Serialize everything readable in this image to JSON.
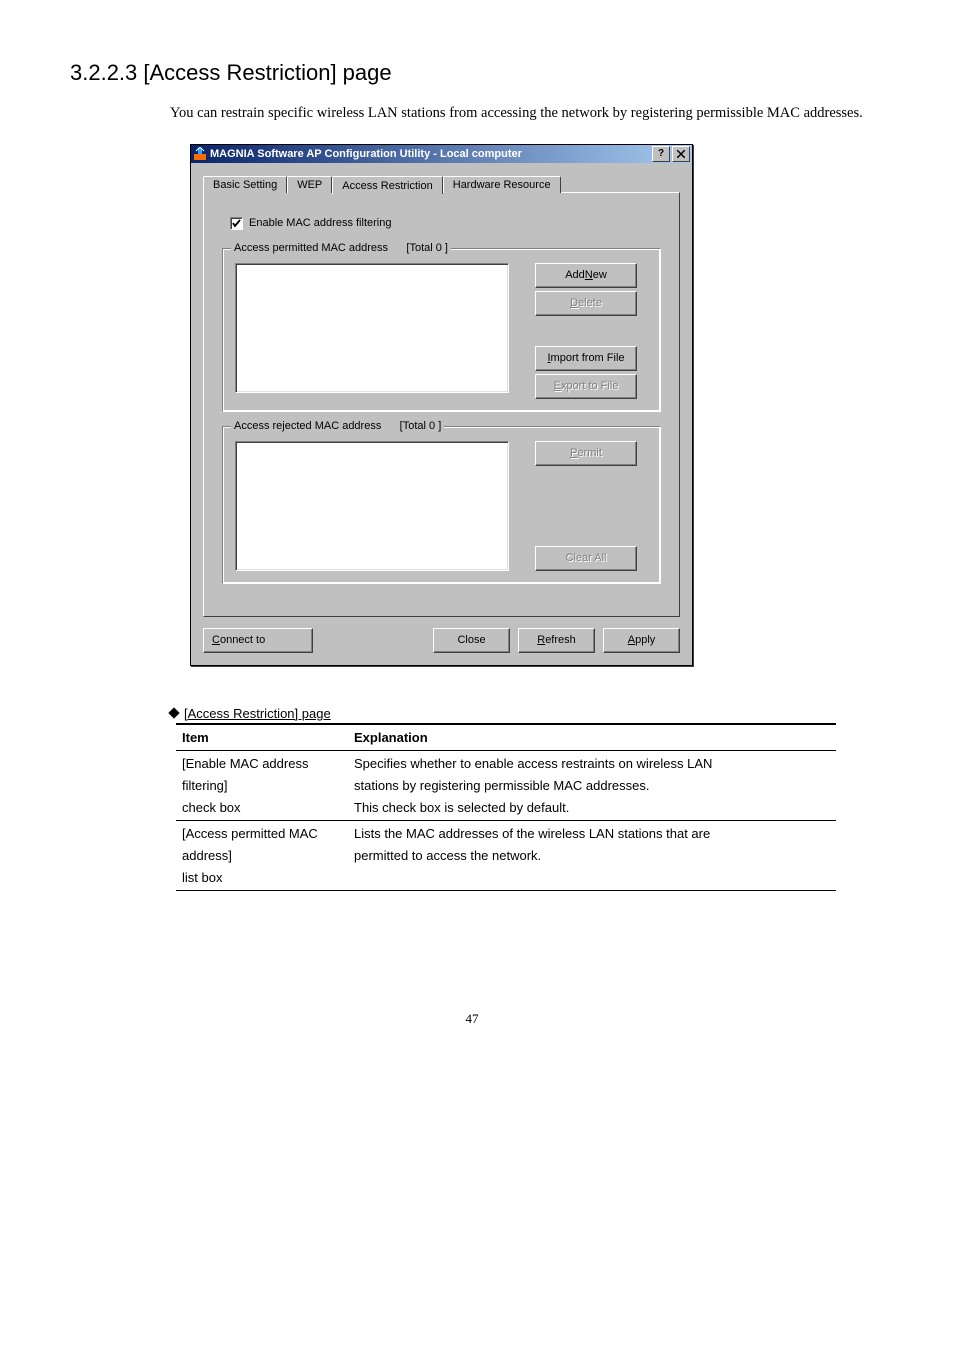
{
  "heading": "3.2.2.3  [Access Restriction] page",
  "intro": "You can restrain specific wireless LAN stations from accessing the network by registering permissible MAC addresses.",
  "window": {
    "title": "MAGNIA Software AP Configuration Utility - Local computer",
    "tabs": {
      "basic": "Basic Setting",
      "wep": "WEP",
      "access": "Access Restriction",
      "hardware": "Hardware Resource"
    },
    "enable_label": "Enable MAC address filtering",
    "permitted": {
      "legend_prefix": "Access permitted MAC address      [Total ",
      "count": "0",
      "legend_suffix": " ]"
    },
    "rejected": {
      "legend_prefix": "Access rejected MAC address      [Total ",
      "count": "0",
      "legend_suffix": " ]"
    },
    "buttons": {
      "add_new_pre": "Add ",
      "add_new_mn": "N",
      "add_new_post": "ew",
      "delete_mn": "D",
      "delete_post": "elete",
      "import_mn": "I",
      "import_post": "mport from File",
      "export_mn": "E",
      "export_post": "xport to File",
      "permit_mn": "P",
      "permit_post": "ermit",
      "clearall": "Clear All",
      "connect_mn": "C",
      "connect_post": "onnect to",
      "close": "Close",
      "refresh_mn": "R",
      "refresh_post": "efresh",
      "apply_mn": "A",
      "apply_post": "pply"
    }
  },
  "table": {
    "caption": "[Access Restriction] page",
    "headers": {
      "item": "Item",
      "explanation": "Explanation"
    },
    "rows": [
      {
        "item_lines": [
          "[Enable MAC address",
          "filtering]",
          "check box"
        ],
        "expl_lines": [
          "Specifies whether to enable access restraints on wireless LAN",
          "stations by registering permissible MAC addresses.",
          "This check box is selected by default."
        ]
      },
      {
        "item_lines": [
          "[Access permitted MAC",
          "address]",
          "list box"
        ],
        "expl_lines": [
          "Lists the MAC addresses of the wireless LAN stations that are",
          "permitted to access the network."
        ]
      }
    ]
  },
  "page_number": "47"
}
